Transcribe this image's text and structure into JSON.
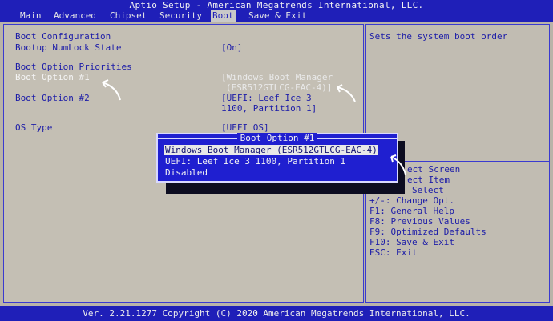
{
  "title": "Aptio Setup - American Megatrends International, LLC.",
  "menu": [
    {
      "label": "Main",
      "active": false
    },
    {
      "label": "Advanced",
      "active": false
    },
    {
      "label": "Chipset",
      "active": false
    },
    {
      "label": "Security",
      "active": false
    },
    {
      "label": "Boot",
      "active": true
    },
    {
      "label": "Save & Exit",
      "active": false
    }
  ],
  "boot": {
    "config_header": "Boot Configuration",
    "numlock_label": "Bootup NumLock State",
    "numlock_value": "[On]",
    "priorities_header": "Boot Option Priorities",
    "option1_label": "Boot Option #1",
    "option1_value_line1": "[Windows Boot Manager",
    "option1_value_line2": "(ESR512GTLCG-EAC-4)]",
    "option2_label": "Boot Option #2",
    "option2_value_line1": "[UEFI: Leef Ice 3",
    "option2_value_line2": "1100, Partition 1]",
    "os_type_label": "OS Type",
    "os_type_value": "[UEFI OS]"
  },
  "help": {
    "description": "Sets the system boot order",
    "keys": [
      "ect Screen",
      "ect Item",
      "Select",
      "+/-: Change Opt.",
      "F1: General Help",
      "F8: Previous Values",
      "F9: Optimized Defaults",
      "F10: Save & Exit",
      "ESC: Exit"
    ]
  },
  "popup": {
    "title": "Boot Option #1",
    "options": [
      "Windows Boot Manager (ESR512GTLCG-EAC-4)",
      "UEFI: Leef Ice 3 1100, Partition 1",
      "Disabled"
    ]
  },
  "footer": "Ver. 2.21.1277 Copyright (C) 2020 American Megatrends International, LLC.",
  "colors": {
    "bios_blue": "#1f1fb8",
    "text_blue": "#1c1ca8",
    "popup_blue": "#1f1fd0"
  }
}
